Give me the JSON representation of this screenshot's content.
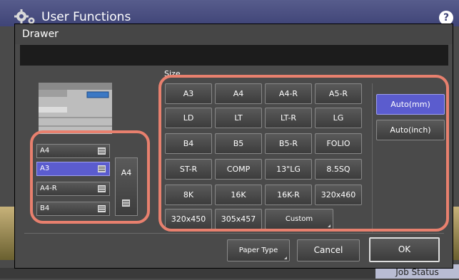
{
  "app": {
    "title": "User Functions",
    "help_label": "?"
  },
  "dialog": {
    "title": "Drawer",
    "size_label": "Size"
  },
  "drawers": [
    {
      "label": "A4",
      "selected": false
    },
    {
      "label": "A3",
      "selected": true
    },
    {
      "label": "A4-R",
      "selected": false
    },
    {
      "label": "B4",
      "selected": false
    }
  ],
  "bypass": {
    "label": "A4"
  },
  "sizes": [
    "A3",
    "A4",
    "A4-R",
    "A5-R",
    "LD",
    "LT",
    "LT-R",
    "LG",
    "B4",
    "B5",
    "B5-R",
    "FOLIO",
    "ST-R",
    "COMP",
    "13\"LG",
    "8.5SQ",
    "8K",
    "16K",
    "16K-R",
    "320x460",
    "320x450",
    "305x457",
    "Custom"
  ],
  "modes": [
    {
      "label": "Auto(mm)",
      "selected": true
    },
    {
      "label": "Auto(inch)",
      "selected": false
    }
  ],
  "footer": {
    "paper_type": "Paper Type",
    "cancel": "Cancel",
    "ok": "OK"
  },
  "job_status": "Job Status",
  "colors": {
    "highlight": "#e8806e",
    "selected": "#5b5cce",
    "header": "#3f4477"
  }
}
